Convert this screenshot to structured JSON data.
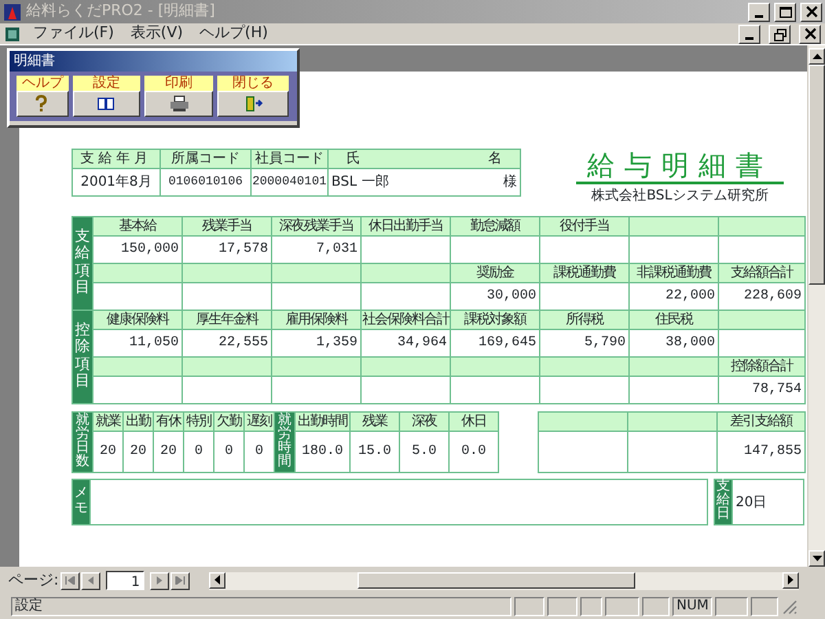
{
  "window": {
    "title": "給料らくだPRO2 - [明細書]"
  },
  "menu": [
    "ファイル(F)",
    "表示(V)",
    "ヘルプ(H)"
  ],
  "toolbar": {
    "title": "明細書",
    "buttons": [
      {
        "label": "ヘルプ",
        "kind": "help"
      },
      {
        "label": "設定",
        "kind": "book"
      },
      {
        "label": "印刷",
        "kind": "print"
      },
      {
        "label": "閉じる",
        "kind": "exit"
      }
    ]
  },
  "slip": {
    "header": {
      "columns": [
        "支給年月",
        "所属コード",
        "社員コード",
        "氏 名"
      ],
      "values": [
        "2001年8月",
        "0106010106",
        "2000040101",
        "BSL 一郎"
      ],
      "honorific": "様"
    },
    "title": "給与明細書",
    "company": "株式会社BSLシステム研究所",
    "sections": [
      {
        "label": "支給項目",
        "rows": [
          [
            "基本給",
            "残業手当",
            "深夜残業手当",
            "休日出勤手当",
            "勤怠減額",
            "役付手当",
            null,
            null
          ],
          [
            "150,000",
            "17,578",
            "7,031",
            null,
            null,
            null,
            null,
            null
          ],
          [
            null,
            null,
            null,
            null,
            "奨励金",
            "課税通勤費",
            "非課税通勤費",
            "支給額合計"
          ],
          [
            null,
            null,
            null,
            null,
            "30,000",
            null,
            "22,000",
            "228,609"
          ]
        ]
      },
      {
        "label": "控除項目",
        "rows": [
          [
            "健康保険料",
            "厚生年金料",
            "雇用保険料",
            "社会保険料合計",
            "課税対象額",
            "所得税",
            "住民税",
            null
          ],
          [
            "11,050",
            "22,555",
            "1,359",
            "34,964",
            "169,645",
            "5,790",
            "38,000",
            null
          ],
          [
            null,
            null,
            null,
            null,
            null,
            null,
            null,
            "控除額合計"
          ],
          [
            null,
            null,
            null,
            null,
            null,
            null,
            null,
            "78,754"
          ]
        ]
      }
    ],
    "attendance": {
      "days_label": "就労日数",
      "days": [
        {
          "label": "就業",
          "value": "20"
        },
        {
          "label": "出勤",
          "value": "20"
        },
        {
          "label": "有休",
          "value": "20"
        },
        {
          "label": "特別",
          "value": "0"
        },
        {
          "label": "欠勤",
          "value": "0"
        },
        {
          "label": "遅刻",
          "value": "0"
        }
      ],
      "hours_label": "就労時間",
      "hours": [
        {
          "label": "出勤時間",
          "value": "180.0"
        },
        {
          "label": "残業",
          "value": "15.0"
        },
        {
          "label": "深夜",
          "value": "5.0"
        },
        {
          "label": "休日",
          "value": "0.0"
        }
      ]
    },
    "net_pay": {
      "label": "差引支給額",
      "value": "147,855"
    },
    "memo": {
      "label": "メモ"
    },
    "payday": {
      "label": "支給日",
      "value": "20日"
    }
  },
  "pager": {
    "label": "ページ:",
    "page": "1"
  },
  "status_bar": {
    "text": "設定",
    "indicator": "NUM"
  }
}
